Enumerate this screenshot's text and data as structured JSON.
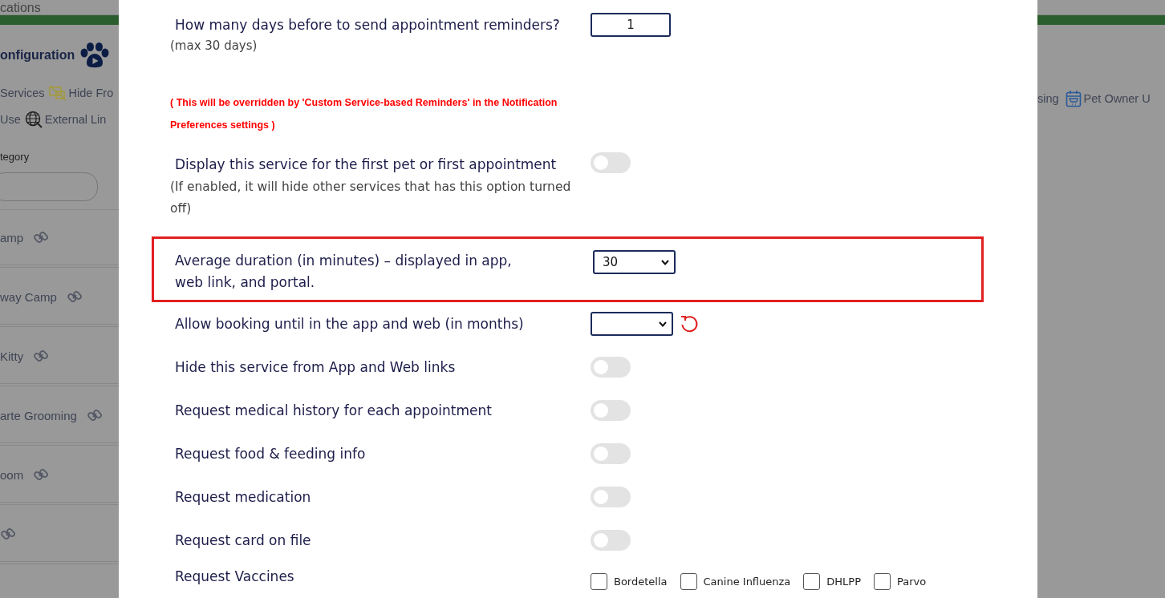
{
  "left_panel": {
    "header_tab": "cations",
    "title": "onfiguration",
    "links": [
      {
        "kind": "plain",
        "label": "Services"
      },
      {
        "kind": "hidden",
        "label": "Hide Fro"
      },
      {
        "kind": "plain",
        "label": "Use"
      },
      {
        "kind": "globe",
        "label": "External Lin"
      }
    ],
    "category_label": "tegory",
    "services": [
      {
        "name": "amp",
        "link": true
      },
      {
        "name": "way Camp",
        "link": true
      },
      {
        "name": "Kitty",
        "link": true
      },
      {
        "name": "arte Grooming",
        "link": true
      },
      {
        "name": "oom",
        "link": true
      },
      {
        "link": true
      }
    ]
  },
  "right_panel": {
    "links": [
      {
        "kind": "plain",
        "label": "sing"
      },
      {
        "kind": "calendar",
        "label": "Pet Owner U"
      }
    ]
  },
  "modal": {
    "rows": [
      {
        "kind": "number",
        "label": "How many days before to send appointment reminders?",
        "hint": "(max 30 days)",
        "value": "1"
      },
      {
        "kind": "note",
        "text": "( This will be overridden by 'Custom Service-based Reminders' in the Notification Preferences settings )"
      },
      {
        "kind": "toggle",
        "label": "Display this service for the first pet or first appointment",
        "hint": "(If enabled, it will hide other services that has this option turned off)",
        "on": false
      },
      {
        "kind": "select",
        "label": "Average duration (in minutes) – displayed in app, web link, and portal.",
        "value": "30",
        "highlighted": true,
        "reset": false
      },
      {
        "kind": "select",
        "label": "Allow booking until in the app and web (in months)",
        "highlighted": false,
        "reset": true
      },
      {
        "kind": "toggle",
        "label": "Hide this service from App and Web links",
        "on": false
      },
      {
        "kind": "toggle",
        "label": "Request medical history for each appointment",
        "on": false
      },
      {
        "kind": "toggle",
        "label": "Request food & feeding info",
        "on": false
      },
      {
        "kind": "toggle",
        "label": "Request medication",
        "on": false
      },
      {
        "kind": "toggle",
        "label": "Request card on file",
        "on": false
      },
      {
        "kind": "checkboxes",
        "label": "Request Vaccines",
        "options": [
          {
            "label": "Bordetella",
            "checked": false
          },
          {
            "label": "Canine Influenza",
            "checked": false
          },
          {
            "label": "DHLPP",
            "checked": false
          },
          {
            "label": "Parvo",
            "checked": false
          }
        ]
      }
    ]
  }
}
